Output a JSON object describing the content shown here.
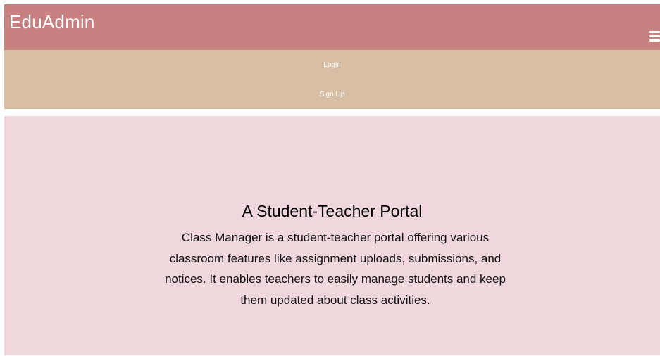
{
  "header": {
    "brand": "EduAdmin",
    "menu_icon": "hamburger-menu-icon"
  },
  "nav": {
    "login_label": "Login",
    "signup_label": "Sign Up"
  },
  "hero": {
    "title": "A Student-Teacher Portal",
    "description": "Class Manager is a student-teacher portal offering various classroom features like assignment uploads, submissions, and notices. It enables teachers to easily manage students and keep them updated about class activities."
  },
  "colors": {
    "header_bg": "#c78180",
    "nav_bg": "#d7bea4",
    "hero_bg": "#efd7dc"
  }
}
